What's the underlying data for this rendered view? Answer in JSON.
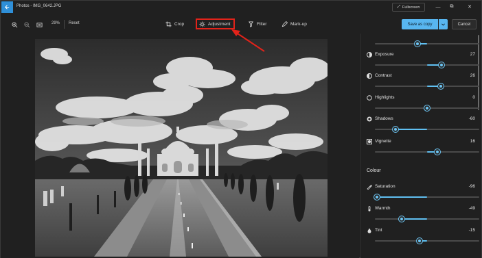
{
  "window": {
    "title": "Photos - IMG_0642.JPG",
    "fullscreen_label": "Fullscreen",
    "minimize_glyph": "—",
    "restore_glyph": "⧉",
    "close_glyph": "✕"
  },
  "toolbar": {
    "zoom_value": "29%",
    "reset_label": "Reset",
    "tools": [
      {
        "label": "Crop",
        "icon": "crop-icon"
      },
      {
        "label": "Adjustment",
        "icon": "sun-icon",
        "highlighted": true
      },
      {
        "label": "Filter",
        "icon": "filter-icon"
      },
      {
        "label": "Mark-up",
        "icon": "pen-icon"
      }
    ],
    "save_label": "Save as copy",
    "cancel_label": "Cancel"
  },
  "panel": {
    "top_slider": {
      "level": 0.41
    },
    "light": [
      {
        "label": "Exposure",
        "value": "27",
        "level": 0.635,
        "icon": "exposure-icon"
      },
      {
        "label": "Contrast",
        "value": "26",
        "level": 0.63,
        "icon": "contrast-icon"
      },
      {
        "label": "Highlights",
        "value": "0",
        "level": 0.5,
        "icon": "highlights-icon"
      },
      {
        "label": "Shadows",
        "value": "-60",
        "level": 0.2,
        "icon": "shadows-icon"
      },
      {
        "label": "Vignette",
        "value": "16",
        "level": 0.6,
        "icon": "vignette-icon"
      }
    ],
    "colour_heading": "Colour",
    "colour": [
      {
        "label": "Saturation",
        "value": "-96",
        "level": 0.02,
        "icon": "saturation-icon"
      },
      {
        "label": "Warmth",
        "value": "-49",
        "level": 0.255,
        "icon": "warmth-icon"
      },
      {
        "label": "Tint",
        "value": "-15",
        "level": 0.425,
        "icon": "tint-icon"
      }
    ]
  },
  "colors": {
    "accent": "#58b6f0",
    "highlight_box": "#e2231a",
    "background": "#202020"
  }
}
